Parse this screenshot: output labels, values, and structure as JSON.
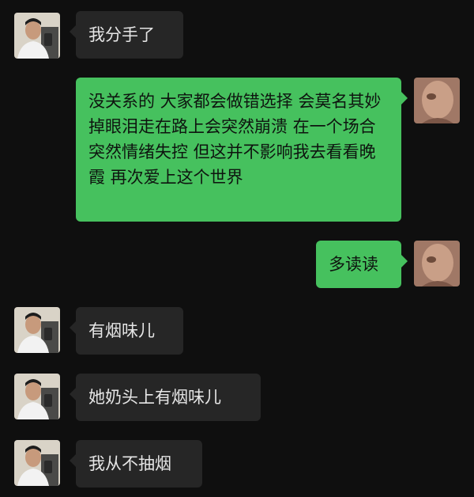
{
  "messages": [
    {
      "side": "in",
      "text": "我分手了"
    },
    {
      "side": "out",
      "text": "没关系的 大家都会做错选择 会莫名其妙掉眼泪走在路上会突然崩溃 在一个场合突然情绪失控 但这并不影响我去看看晚霞 再次爱上这个世界"
    },
    {
      "side": "out",
      "text": "多读读"
    },
    {
      "side": "in",
      "text": "有烟味儿"
    },
    {
      "side": "in",
      "text": "她奶头上有烟味儿"
    },
    {
      "side": "in",
      "text": "我从不抽烟"
    }
  ],
  "colors": {
    "background": "#0f0f0f",
    "incoming_bubble": "#262626",
    "outgoing_bubble": "#46c15e"
  },
  "icons": {
    "contact_avatar": "man-selfie-avatar",
    "self_avatar": "blurry-face-avatar"
  }
}
